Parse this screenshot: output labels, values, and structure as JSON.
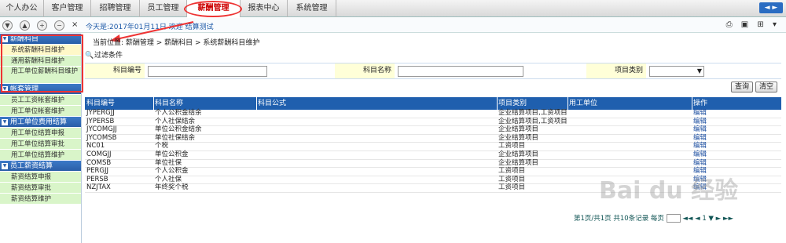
{
  "top_tabs": [
    "个人办公",
    "客户管理",
    "招聘管理",
    "员工管理",
    "薪酬管理",
    "报表中心",
    "系统管理"
  ],
  "active_tab": "薪酬管理",
  "subbar": {
    "buttons": [
      "▼",
      "▲",
      "+",
      "−"
    ],
    "close": "×",
    "today": "今天是:2017年01月11日 欢迎 结算测试"
  },
  "sidebar": {
    "groups": [
      {
        "label": "薪酬科目",
        "items": [
          "系统薪酬科目维护",
          "通用薪酬科目维护",
          "用工单位薪酬科目维护"
        ]
      },
      {
        "label": "帐套管理",
        "items": [
          "员工工资帐套维护",
          "用工单位帐套维护"
        ]
      },
      {
        "label": "用工单位费用结算",
        "items": [
          "用工单位结算申报",
          "用工单位结算审批",
          "用工单位结算维护"
        ]
      },
      {
        "label": "员工薪资结算",
        "items": [
          "薪资结算申报",
          "薪资结算审批",
          "薪资结算维护"
        ]
      }
    ]
  },
  "breadcrumb": "当前位置: 薪酬管理 > 薪酬科目 > 系统薪酬科目维护",
  "filter": {
    "title": "过滤条件",
    "code_label": "科目编号",
    "name_label": "科目名称",
    "type_label": "项目类别",
    "query_button": "查询",
    "clear_button": "清空"
  },
  "table": {
    "headers": [
      "科目编号",
      "科目名称",
      "科目公式",
      "项目类别",
      "用工单位",
      "操作"
    ],
    "rows": [
      {
        "code": "JYPERGJJ",
        "name": "个人公积金结余",
        "formula": "",
        "type": "企业结算项目,工资项目",
        "unit": "",
        "op": "编辑"
      },
      {
        "code": "JYPERSB",
        "name": "个人社保结余",
        "formula": "",
        "type": "企业结算项目,工资项目",
        "unit": "",
        "op": "编辑"
      },
      {
        "code": "JYCOMGJJ",
        "name": "单位公积金结余",
        "formula": "",
        "type": "企业结算项目",
        "unit": "",
        "op": "编辑"
      },
      {
        "code": "JYCOMSB",
        "name": "单位社保结余",
        "formula": "",
        "type": "企业结算项目",
        "unit": "",
        "op": "编辑"
      },
      {
        "code": "NC01",
        "name": "个税",
        "formula": "",
        "type": "工资项目",
        "unit": "",
        "op": "编辑"
      },
      {
        "code": "COMGJJ",
        "name": "单位公积金",
        "formula": "",
        "type": "企业结算项目",
        "unit": "",
        "op": "编辑"
      },
      {
        "code": "COMSB",
        "name": "单位社保",
        "formula": "",
        "type": "企业结算项目",
        "unit": "",
        "op": "编辑"
      },
      {
        "code": "PERGJJ",
        "name": "个人公积金",
        "formula": "",
        "type": "工资项目",
        "unit": "",
        "op": "编辑"
      },
      {
        "code": "PERSB",
        "name": "个人社保",
        "formula": "",
        "type": "工资项目",
        "unit": "",
        "op": "编辑"
      },
      {
        "code": "NZJTAX",
        "name": "年终奖个税",
        "formula": "",
        "type": "工资项目",
        "unit": "",
        "op": "编辑"
      }
    ]
  },
  "pager": {
    "text": "第1页/共1页 共10条记录 每页",
    "nav": "◄◄ ◄ 1 ▼ ► ►►"
  },
  "watermark": "Bai du 经验",
  "colors": {
    "header_blue": "#1f5fae",
    "sidebar_item": "#d9f5c9",
    "highlight_red": "#e33"
  }
}
